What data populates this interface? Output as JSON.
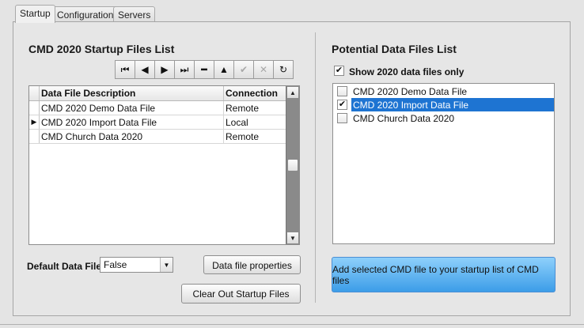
{
  "tabs": [
    "Startup",
    "Configuration",
    "Servers"
  ],
  "left": {
    "title": "CMD 2020 Startup Files List",
    "grid": {
      "headers": [
        "Data File Description",
        "Connection"
      ],
      "rows": [
        {
          "description": "CMD 2020 Demo Data File",
          "connection": "Remote",
          "current": false
        },
        {
          "description": "CMD 2020 Import Data File",
          "connection": "Local",
          "current": true
        },
        {
          "description": "CMD Church Data 2020",
          "connection": "Remote",
          "current": false
        }
      ]
    },
    "navigator": [
      "first-icon",
      "prior-icon",
      "next-icon",
      "last-icon",
      "delete-icon",
      "edit-icon",
      "post-icon",
      "cancel-icon",
      "refresh-icon"
    ],
    "default_label": "Default Data File",
    "default_value": "False",
    "properties_button": "Data file properties",
    "clear_button": "Clear Out Startup Files"
  },
  "right": {
    "title": "Potential Data Files List",
    "show_only_label": "Show 2020 data files only",
    "show_only_checked": true,
    "items": [
      {
        "label": "CMD 2020 Demo Data File",
        "checked": false,
        "selected": false
      },
      {
        "label": "CMD 2020 Import Data File",
        "checked": true,
        "selected": true
      },
      {
        "label": "CMD Church Data 2020",
        "checked": false,
        "selected": false
      }
    ],
    "add_button": "Add selected CMD file to your startup list of CMD files"
  },
  "colors": {
    "selection": "#1e74d2",
    "add_button": "#5cb3f2"
  }
}
